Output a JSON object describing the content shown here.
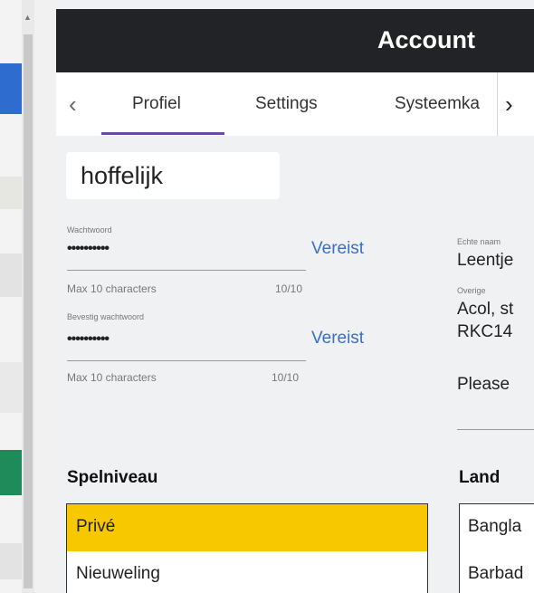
{
  "header": {
    "title": "Account"
  },
  "tabs": [
    {
      "label": "Profiel",
      "active": true
    },
    {
      "label": "Settings"
    },
    {
      "label": "Systeemka"
    }
  ],
  "profile": {
    "username": "hoffelijk",
    "password": {
      "label": "Wachtwoord",
      "value": "••••••••••",
      "required_text": "Vereist",
      "hint": "Max 10 characters",
      "counter": "10/10"
    },
    "confirm_password": {
      "label": "Bevestig wachtwoord",
      "value": "••••••••••",
      "required_text": "Vereist",
      "hint": "Max 10 characters",
      "counter": "10/10"
    },
    "real_name": {
      "label": "Echte naam",
      "value": "Leentje"
    },
    "other": {
      "label": "Overige",
      "line1": "Acol, st",
      "line2": "RKC14",
      "line3": "Please"
    }
  },
  "level": {
    "title": "Spelniveau",
    "options": [
      "Privé",
      "Nieuweling"
    ],
    "selected": "Privé",
    "selected_color": "#f7c800"
  },
  "country": {
    "title": "Land",
    "options": [
      "Bangla",
      "Barbad"
    ]
  },
  "colors": {
    "header": "#222326",
    "accent": "#6a4ba0",
    "link": "#3b6fc2",
    "panel": "#eff1f3"
  }
}
